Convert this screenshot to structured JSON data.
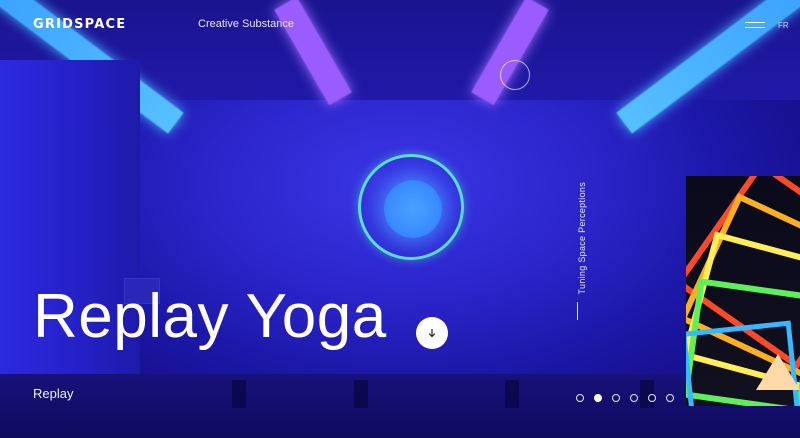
{
  "header": {
    "logo": "GRIDSPACE",
    "tagline": "Creative Substance",
    "menu_icon": "hamburger-menu-icon",
    "language": "FR"
  },
  "hero": {
    "title": "Replay Yoga",
    "subtitle": "Replay",
    "scroll_icon": "arrow-down-icon"
  },
  "side_caption": "Tuning Space Perceptions",
  "slider": {
    "total": 6,
    "active_index": 1
  },
  "next_project": {
    "thumbnail": "neon-frames-image"
  },
  "colors": {
    "background": "#1f1ab8",
    "orb_ring": "#58e0d2",
    "orb_core": "#4aa2ff",
    "ceiling_light_blue": "#56c0ff",
    "ceiling_light_purple": "#9b5cff"
  }
}
